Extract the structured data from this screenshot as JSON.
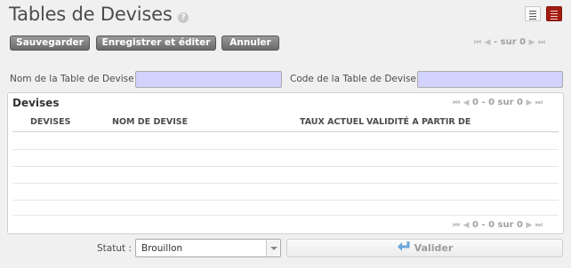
{
  "header": {
    "title": "Tables de Devises",
    "help": "?",
    "icons": [
      "list-view-icon",
      "form-view-icon"
    ]
  },
  "toolbar": {
    "save_label": "Sauvegarder",
    "save_edit_label": "Enregistrer et éditer",
    "cancel_label": "Annuler"
  },
  "pager_top": {
    "text": "- sur 0"
  },
  "form": {
    "name_label": "Nom de la Table de Devise :",
    "code_label": "Code de la Table de Devise :",
    "name_value": "",
    "code_value": ""
  },
  "grid": {
    "title": "Devises",
    "pager_text": "0 - 0 sur 0",
    "pager_bottom_text": "0 - 0 sur 0",
    "columns": [
      "DEVISES",
      "NOM DE DEVISE",
      "TAUX ACTUEL",
      "VALIDITÉ A PARTIR DE"
    ]
  },
  "footer": {
    "status_label": "Statut :",
    "status_value": "Brouillon",
    "validate_label": "Valider"
  },
  "colors": {
    "required_field": "#d2d2ff",
    "form_view_active": "#a31c12",
    "button_gray": "#7a7a7a"
  }
}
